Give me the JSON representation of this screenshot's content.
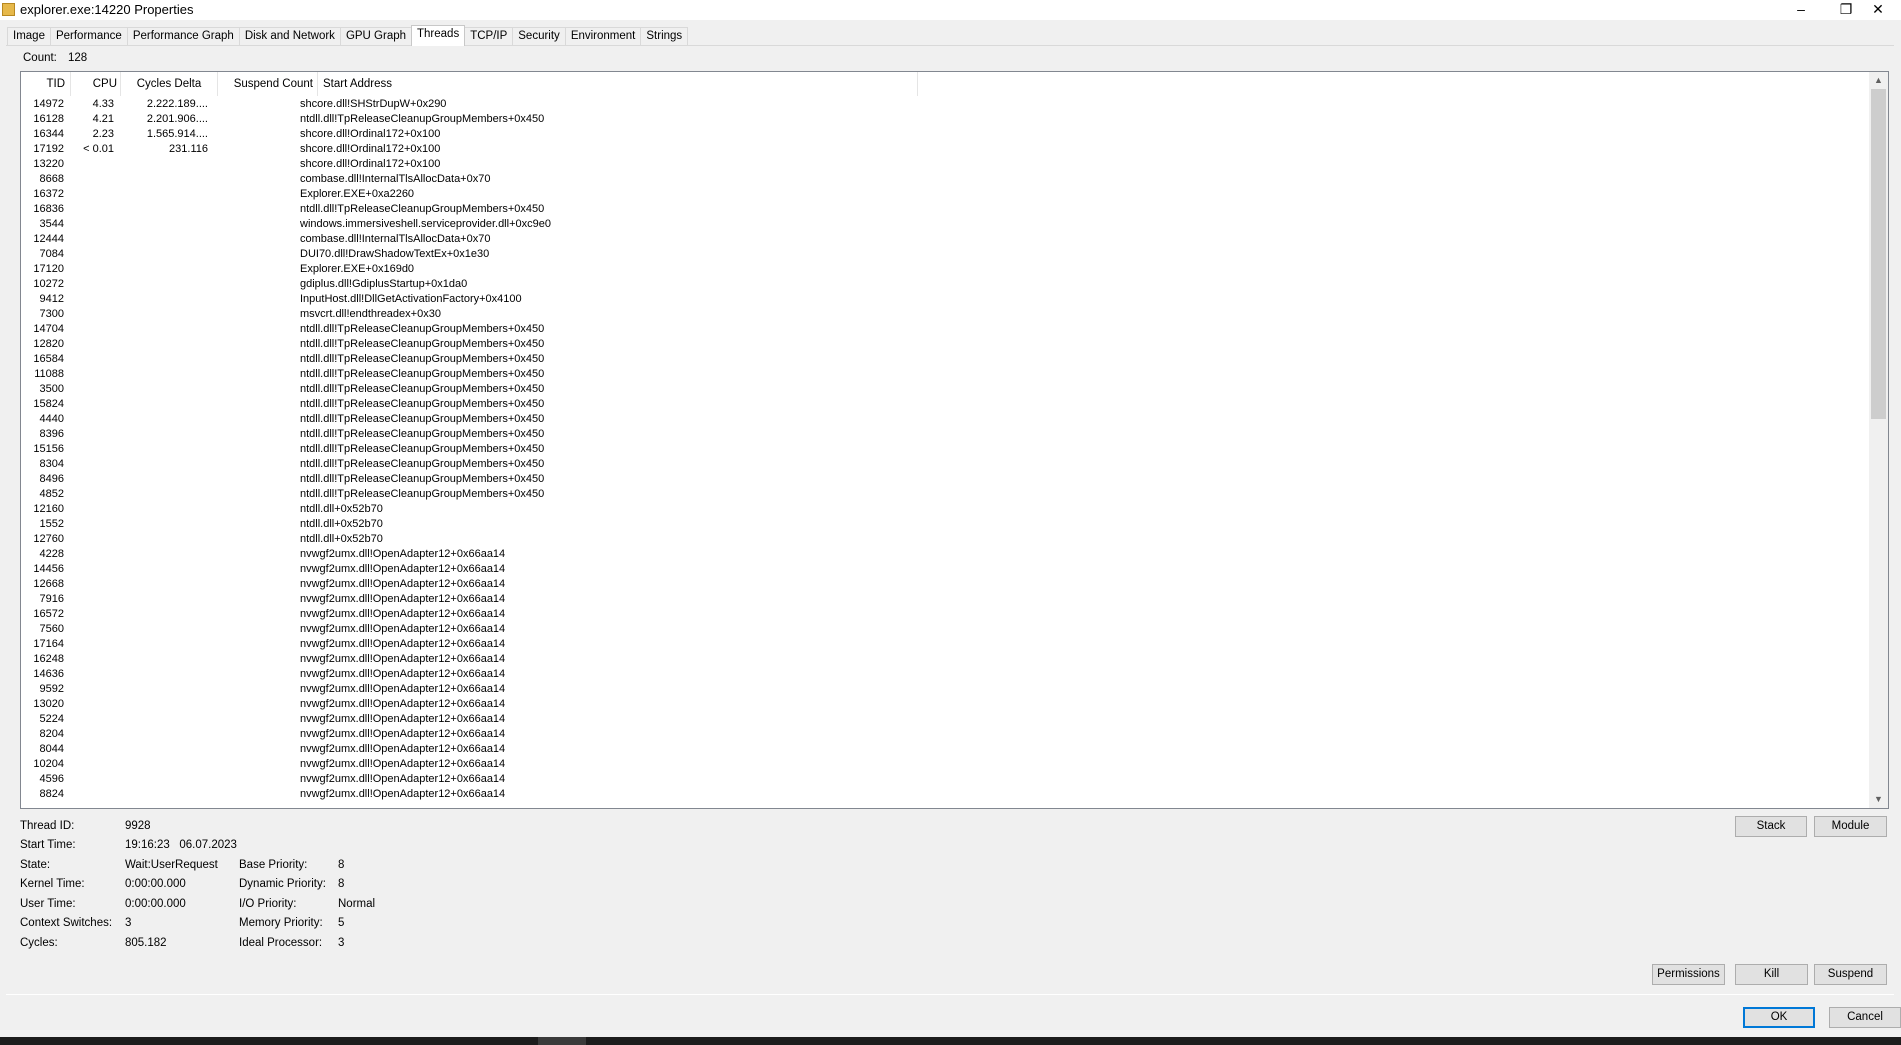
{
  "window": {
    "title": "explorer.exe:14220 Properties"
  },
  "tabs": [
    {
      "label": "Image",
      "active": false
    },
    {
      "label": "Performance",
      "active": false
    },
    {
      "label": "Performance Graph",
      "active": false
    },
    {
      "label": "Disk and Network",
      "active": false
    },
    {
      "label": "GPU Graph",
      "active": false
    },
    {
      "label": "Threads",
      "active": true
    },
    {
      "label": "TCP/IP",
      "active": false
    },
    {
      "label": "Security",
      "active": false
    },
    {
      "label": "Environment",
      "active": false
    },
    {
      "label": "Strings",
      "active": false
    }
  ],
  "count": {
    "label": "Count:",
    "value": "128"
  },
  "columns": {
    "tid": "TID",
    "cpu": "CPU",
    "cycles": "Cycles Delta",
    "suspend": "Suspend Count",
    "address": "Start Address"
  },
  "threads": [
    {
      "tid": "14972",
      "cpu": "4.33",
      "cycles": "2.222.189....",
      "address": "shcore.dll!SHStrDupW+0x290"
    },
    {
      "tid": "16128",
      "cpu": "4.21",
      "cycles": "2.201.906....",
      "address": "ntdll.dll!TpReleaseCleanupGroupMembers+0x450"
    },
    {
      "tid": "16344",
      "cpu": "2.23",
      "cycles": "1.565.914....",
      "address": "shcore.dll!Ordinal172+0x100"
    },
    {
      "tid": "17192",
      "cpu": "< 0.01",
      "cycles": "231.116",
      "address": "shcore.dll!Ordinal172+0x100"
    },
    {
      "tid": "13220",
      "cpu": "",
      "cycles": "",
      "address": "shcore.dll!Ordinal172+0x100"
    },
    {
      "tid": "8668",
      "cpu": "",
      "cycles": "",
      "address": "combase.dll!InternalTlsAllocData+0x70"
    },
    {
      "tid": "16372",
      "cpu": "",
      "cycles": "",
      "address": "Explorer.EXE+0xa2260"
    },
    {
      "tid": "16836",
      "cpu": "",
      "cycles": "",
      "address": "ntdll.dll!TpReleaseCleanupGroupMembers+0x450"
    },
    {
      "tid": "3544",
      "cpu": "",
      "cycles": "",
      "address": "windows.immersiveshell.serviceprovider.dll+0xc9e0"
    },
    {
      "tid": "12444",
      "cpu": "",
      "cycles": "",
      "address": "combase.dll!InternalTlsAllocData+0x70"
    },
    {
      "tid": "7084",
      "cpu": "",
      "cycles": "",
      "address": "DUI70.dll!DrawShadowTextEx+0x1e30"
    },
    {
      "tid": "17120",
      "cpu": "",
      "cycles": "",
      "address": "Explorer.EXE+0x169d0"
    },
    {
      "tid": "10272",
      "cpu": "",
      "cycles": "",
      "address": "gdiplus.dll!GdiplusStartup+0x1da0"
    },
    {
      "tid": "9412",
      "cpu": "",
      "cycles": "",
      "address": "InputHost.dll!DllGetActivationFactory+0x4100"
    },
    {
      "tid": "7300",
      "cpu": "",
      "cycles": "",
      "address": "msvcrt.dll!endthreadex+0x30"
    },
    {
      "tid": "14704",
      "cpu": "",
      "cycles": "",
      "address": "ntdll.dll!TpReleaseCleanupGroupMembers+0x450"
    },
    {
      "tid": "12820",
      "cpu": "",
      "cycles": "",
      "address": "ntdll.dll!TpReleaseCleanupGroupMembers+0x450"
    },
    {
      "tid": "16584",
      "cpu": "",
      "cycles": "",
      "address": "ntdll.dll!TpReleaseCleanupGroupMembers+0x450"
    },
    {
      "tid": "11088",
      "cpu": "",
      "cycles": "",
      "address": "ntdll.dll!TpReleaseCleanupGroupMembers+0x450"
    },
    {
      "tid": "3500",
      "cpu": "",
      "cycles": "",
      "address": "ntdll.dll!TpReleaseCleanupGroupMembers+0x450"
    },
    {
      "tid": "15824",
      "cpu": "",
      "cycles": "",
      "address": "ntdll.dll!TpReleaseCleanupGroupMembers+0x450"
    },
    {
      "tid": "4440",
      "cpu": "",
      "cycles": "",
      "address": "ntdll.dll!TpReleaseCleanupGroupMembers+0x450"
    },
    {
      "tid": "8396",
      "cpu": "",
      "cycles": "",
      "address": "ntdll.dll!TpReleaseCleanupGroupMembers+0x450"
    },
    {
      "tid": "15156",
      "cpu": "",
      "cycles": "",
      "address": "ntdll.dll!TpReleaseCleanupGroupMembers+0x450"
    },
    {
      "tid": "8304",
      "cpu": "",
      "cycles": "",
      "address": "ntdll.dll!TpReleaseCleanupGroupMembers+0x450"
    },
    {
      "tid": "8496",
      "cpu": "",
      "cycles": "",
      "address": "ntdll.dll!TpReleaseCleanupGroupMembers+0x450"
    },
    {
      "tid": "4852",
      "cpu": "",
      "cycles": "",
      "address": "ntdll.dll!TpReleaseCleanupGroupMembers+0x450"
    },
    {
      "tid": "12160",
      "cpu": "",
      "cycles": "",
      "address": "ntdll.dll+0x52b70"
    },
    {
      "tid": "1552",
      "cpu": "",
      "cycles": "",
      "address": "ntdll.dll+0x52b70"
    },
    {
      "tid": "12760",
      "cpu": "",
      "cycles": "",
      "address": "ntdll.dll+0x52b70"
    },
    {
      "tid": "4228",
      "cpu": "",
      "cycles": "",
      "address": "nvwgf2umx.dll!OpenAdapter12+0x66aa14"
    },
    {
      "tid": "14456",
      "cpu": "",
      "cycles": "",
      "address": "nvwgf2umx.dll!OpenAdapter12+0x66aa14"
    },
    {
      "tid": "12668",
      "cpu": "",
      "cycles": "",
      "address": "nvwgf2umx.dll!OpenAdapter12+0x66aa14"
    },
    {
      "tid": "7916",
      "cpu": "",
      "cycles": "",
      "address": "nvwgf2umx.dll!OpenAdapter12+0x66aa14"
    },
    {
      "tid": "16572",
      "cpu": "",
      "cycles": "",
      "address": "nvwgf2umx.dll!OpenAdapter12+0x66aa14"
    },
    {
      "tid": "7560",
      "cpu": "",
      "cycles": "",
      "address": "nvwgf2umx.dll!OpenAdapter12+0x66aa14"
    },
    {
      "tid": "17164",
      "cpu": "",
      "cycles": "",
      "address": "nvwgf2umx.dll!OpenAdapter12+0x66aa14"
    },
    {
      "tid": "16248",
      "cpu": "",
      "cycles": "",
      "address": "nvwgf2umx.dll!OpenAdapter12+0x66aa14"
    },
    {
      "tid": "14636",
      "cpu": "",
      "cycles": "",
      "address": "nvwgf2umx.dll!OpenAdapter12+0x66aa14"
    },
    {
      "tid": "9592",
      "cpu": "",
      "cycles": "",
      "address": "nvwgf2umx.dll!OpenAdapter12+0x66aa14"
    },
    {
      "tid": "13020",
      "cpu": "",
      "cycles": "",
      "address": "nvwgf2umx.dll!OpenAdapter12+0x66aa14"
    },
    {
      "tid": "5224",
      "cpu": "",
      "cycles": "",
      "address": "nvwgf2umx.dll!OpenAdapter12+0x66aa14"
    },
    {
      "tid": "8204",
      "cpu": "",
      "cycles": "",
      "address": "nvwgf2umx.dll!OpenAdapter12+0x66aa14"
    },
    {
      "tid": "8044",
      "cpu": "",
      "cycles": "",
      "address": "nvwgf2umx.dll!OpenAdapter12+0x66aa14"
    },
    {
      "tid": "10204",
      "cpu": "",
      "cycles": "",
      "address": "nvwgf2umx.dll!OpenAdapter12+0x66aa14"
    },
    {
      "tid": "4596",
      "cpu": "",
      "cycles": "",
      "address": "nvwgf2umx.dll!OpenAdapter12+0x66aa14"
    },
    {
      "tid": "8824",
      "cpu": "",
      "cycles": "",
      "address": "nvwgf2umx.dll!OpenAdapter12+0x66aa14"
    }
  ],
  "details": {
    "thread_id": {
      "label": "Thread ID:",
      "value": "9928"
    },
    "start_time": {
      "label": "Start Time:",
      "value": "19:16:23   06.07.2023"
    },
    "state": {
      "label": "State:",
      "value": "Wait:UserRequest"
    },
    "kernel_time": {
      "label": "Kernel Time:",
      "value": "0:00:00.000"
    },
    "user_time": {
      "label": "User Time:",
      "value": "0:00:00.000"
    },
    "context_switches": {
      "label": "Context Switches:",
      "value": "3"
    },
    "cycles": {
      "label": "Cycles:",
      "value": "805.182"
    },
    "base_priority": {
      "label": "Base Priority:",
      "value": "8"
    },
    "dynamic_priority": {
      "label": "Dynamic Priority:",
      "value": "8"
    },
    "io_priority": {
      "label": "I/O Priority:",
      "value": "Normal"
    },
    "memory_priority": {
      "label": "Memory Priority:",
      "value": "5"
    },
    "ideal_processor": {
      "label": "Ideal Processor:",
      "value": "3"
    }
  },
  "buttons": {
    "stack": "Stack",
    "module": "Module",
    "permissions": "Permissions",
    "kill": "Kill",
    "suspend": "Suspend",
    "ok": "OK",
    "cancel": "Cancel"
  },
  "icons": {
    "minimize": "minimize-icon",
    "restore": "restore-icon",
    "close": "close-icon",
    "app": "explorer-app-icon"
  },
  "colors": {
    "accent": "#0078d7",
    "panel": "#f0f0f0",
    "list_bg": "#ffffff"
  }
}
